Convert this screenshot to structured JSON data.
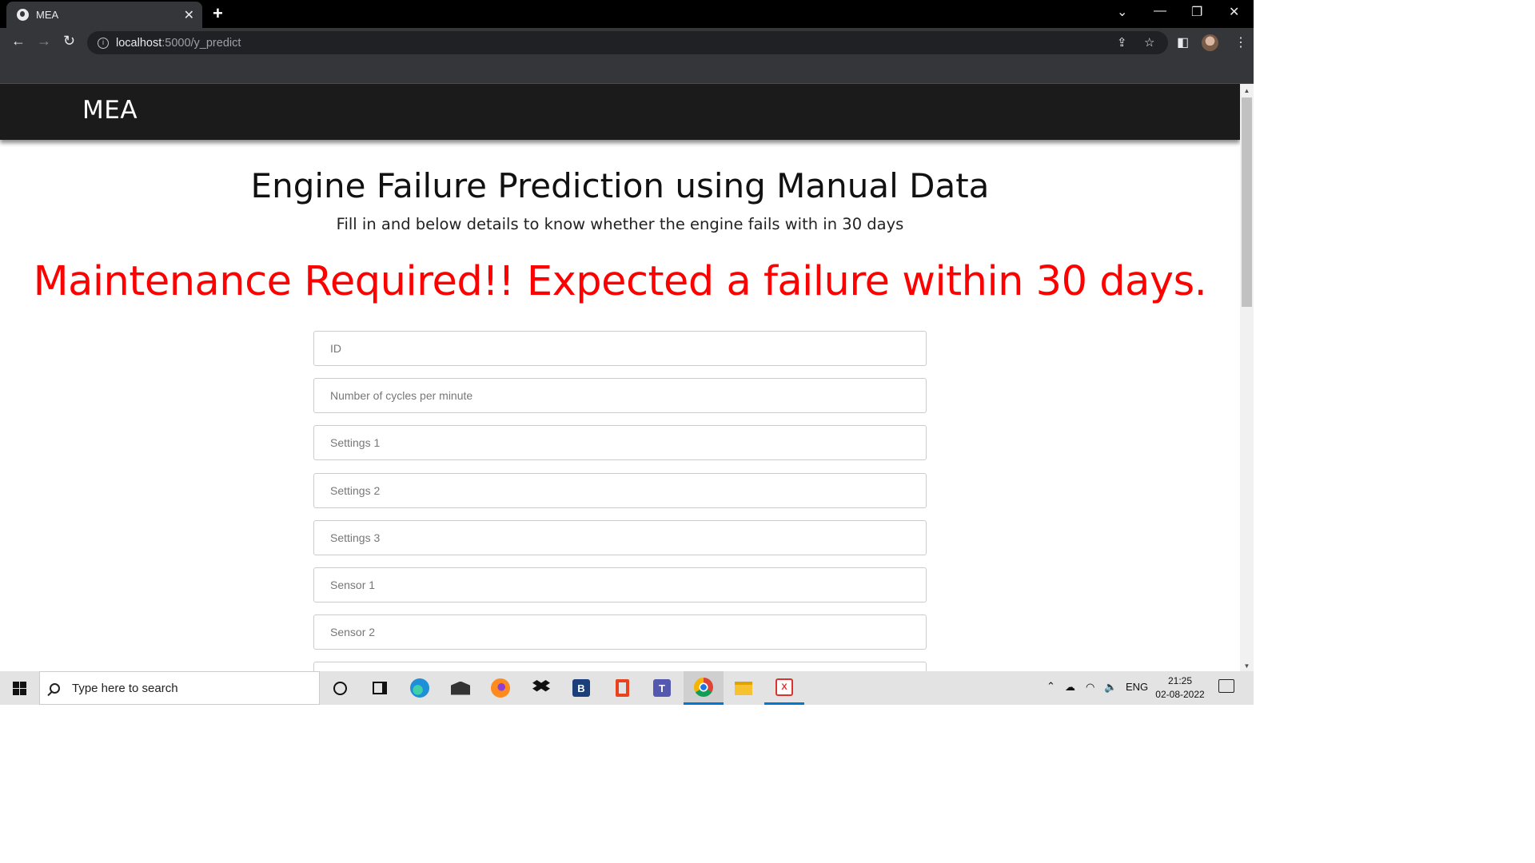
{
  "browser": {
    "tab_title": "MEA",
    "new_tab_symbol": "+",
    "url_host": "localhost",
    "url_path": ":5000/y_predict"
  },
  "site": {
    "brand": "MEA"
  },
  "page": {
    "title": "Engine Failure Prediction using Manual Data",
    "subtitle": "Fill in and below details to know whether the engine fails with in 30 days",
    "result": "Maintenance Required!! Expected a failure within 30 days.",
    "result_color": "#ff0000"
  },
  "form": {
    "fields": [
      {
        "placeholder": "ID"
      },
      {
        "placeholder": "Number of cycles per minute"
      },
      {
        "placeholder": "Settings 1"
      },
      {
        "placeholder": "Settings 2"
      },
      {
        "placeholder": "Settings 3"
      },
      {
        "placeholder": "Sensor 1"
      },
      {
        "placeholder": "Sensor 2"
      }
    ]
  },
  "taskbar": {
    "search_placeholder": "Type here to search",
    "language": "ENG",
    "time": "21:25",
    "date": "02-08-2022",
    "apps": [
      "cortana-icon",
      "task-view-icon",
      "edge-icon",
      "mail-icon",
      "firefox-icon",
      "dropbox-icon",
      "bitdefender-icon",
      "office-icon",
      "teams-icon",
      "chrome-icon",
      "file-explorer-icon",
      "xampp-icon"
    ],
    "office_letter": "B"
  }
}
